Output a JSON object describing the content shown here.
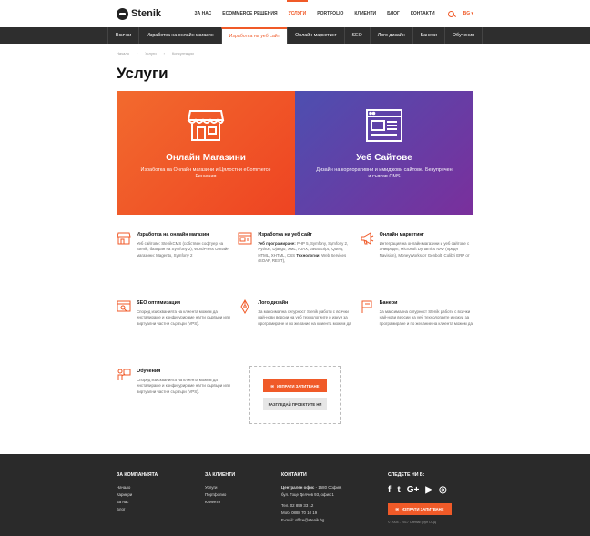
{
  "header": {
    "logo_text": "Stenik",
    "nav": [
      "ЗА НАС",
      "ECOMMERCE РЕШЕНИЯ",
      "УСЛУГИ",
      "PORTFOLIO",
      "КЛИЕНТИ",
      "БЛОГ",
      "КОНТАКТИ"
    ],
    "active_nav": "УСЛУГИ",
    "lang": "BG"
  },
  "subnav": {
    "items": [
      "Всички",
      "Изработка на онлайн магазин",
      "Изработка на уеб сайт",
      "Онлайн маркетинг",
      "SEO",
      "Лого дизайн",
      "Банери",
      "Обучения"
    ],
    "active": "Изработка на уеб сайт"
  },
  "breadcrumb": [
    "Начало",
    "Услуги",
    "Консултации"
  ],
  "page_title": "Услуги",
  "heroes": [
    {
      "title": "Онлайн Магазини",
      "text": "Изработка на Онлайн магазини и Цялостни eCommerce Решения",
      "color": "#f05a28"
    },
    {
      "title": "Уеб Сайтове",
      "text": "Дизайн на корпоративни и имиджови сайтове. Безупречен и гъвкав CMS",
      "color": "#5a3fa8"
    }
  ],
  "services": [
    {
      "title": "Изработка на онлайн магазин",
      "text": "Уеб сайтове: StenikCMS (собствен софтуер на Stenik, базиран на Symfony 2), WordPress Онлайн магазини: Magento, Symfony 2",
      "icon": "store-icon"
    },
    {
      "title": "Изработка на уеб сайт",
      "prefix1": "Уеб програмиране:",
      "text1": "PHP 5, Symfony, Symfony 2, Python, Django, XML, AJAX, JavaScript, jQuery, HTML, XHTML, CSS",
      "prefix2": "Технологии:",
      "text2": "Web Services (SOAP, REST),",
      "icon": "browser-icon"
    },
    {
      "title": "Онлайн маркетинг",
      "text": "Интеграция на онлайн магазини и уеб сайтове с Уникредит, Microsoft Dynamics NAV (предн Navision), MoneyWorks от Genbolt, Colibri ERP от",
      "icon": "megaphone-icon"
    },
    {
      "title": "SEO оптимизация",
      "text": "Според изискванията на клиента можем да инсталираме и конфигурираме нагти сървъри или виртуални частни сървъри (VPS).",
      "icon": "seo-icon"
    },
    {
      "title": "Лого дизайн",
      "text": "За максимална сигурност Stenik работи с всички най-нови версии на уеб технологиите и изкуи за програмиране и по желание на клиента можем да",
      "icon": "pen-icon"
    },
    {
      "title": "Банери",
      "text": "За максимална сигурност Stenik работи с всички най-нови версии на уеб технологиите и изкуи за програмиране и по желание на клиента можем да",
      "icon": "banner-icon"
    },
    {
      "title": "Обучения",
      "text": "Според изискванията на клиента можем да инсталираме и конфигурираме нагти сървъри или виртуални частни сървъри (VPS).",
      "icon": "training-icon"
    }
  ],
  "cta": {
    "primary": "ИЗПРАТИ ЗАПИТВАНЕ",
    "secondary": "РАЗГЛЕДАЙ ПРОЕКТИТЕ НИ"
  },
  "footer": {
    "company": {
      "title": "ЗА КОМПАНИЯТА",
      "items": [
        "Начало",
        "Кариери",
        "За нас",
        "Блог"
      ]
    },
    "clients": {
      "title": "ЗА КЛИЕНТИ",
      "items": [
        "Услуги",
        "Портфолио",
        "Клиенти"
      ]
    },
    "contacts": {
      "title": "КОНТАКТИ",
      "office_label": "Централен офис",
      "office": " - 1680 София,",
      "address": "бул. Гоце Делчев 93, офис 1",
      "phone": "Тел. 02 859 33 12",
      "mobile": "Моб. 0888 70 10 19",
      "email": "E-mail: office@stenik.bg"
    },
    "follow": {
      "title": "СЛЕДЕТЕ НИ В:",
      "icons": [
        "f",
        "t",
        "G+",
        "▶",
        "◎"
      ],
      "button": "ИЗПРАТИ ЗАПИТВАНЕ"
    },
    "copyright": "© 2004 - 2017 Стеник Груп ООД"
  }
}
